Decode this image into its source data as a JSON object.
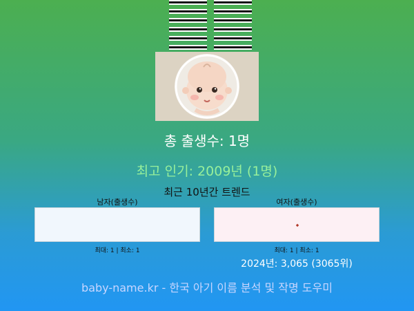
{
  "header": {
    "emblem_icon": "hexagram-icon",
    "image_icon": "baby-face-icon"
  },
  "summary": {
    "total_births": "총 출생수: 1명",
    "top_popularity": "최고 인기: 2009년 (1명)",
    "trend_title": "최근 10년간 트렌드"
  },
  "male_panel": {
    "title": "남자(출생수)",
    "stats": "최대: 1 | 최소: 1",
    "chart_data": {
      "type": "scatter",
      "points": []
    }
  },
  "female_panel": {
    "title": "여자(출생수)",
    "stats": "최대: 1 | 최소: 1",
    "latest": "2024년: 3,065 (3065위)",
    "chart_data": {
      "type": "scatter",
      "points": [
        {
          "value": 1
        }
      ]
    }
  },
  "footer": {
    "text": "baby-name.kr - 한국 아기 이름 분석 및 작명 도우미"
  },
  "colors": {
    "male_bg": "#f1f7fd",
    "female_bg": "#fdf0f4",
    "female_point": "#b23a2a",
    "top_text": "#98f09a"
  }
}
